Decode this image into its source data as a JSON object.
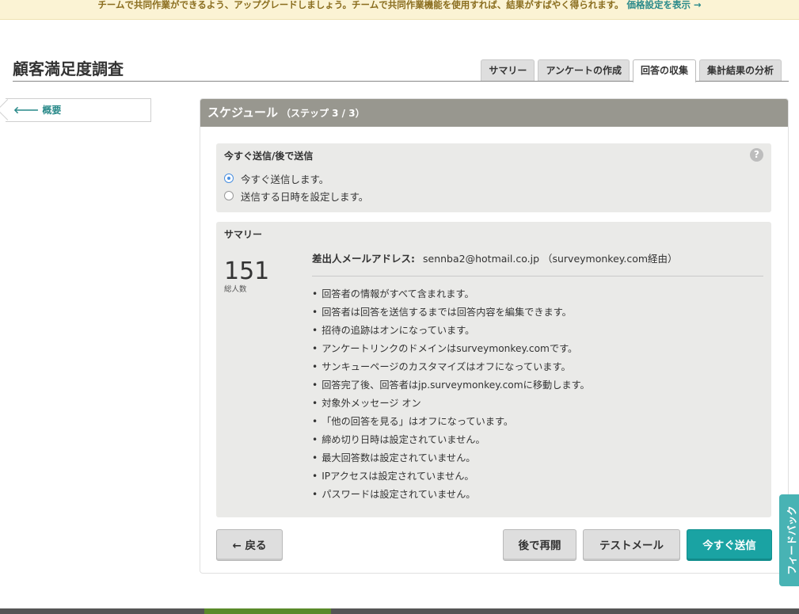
{
  "banner": {
    "text": "チームで共同作業ができるよう、アップグレードしましょう。チームで共同作業機能を使用すれば、結果がすばやく得られます。",
    "link": "価格設定を表示 →"
  },
  "page_title": "顧客満足度調査",
  "tabs": [
    "サマリー",
    "アンケートの作成",
    "回答の収集",
    "集計結果の分析"
  ],
  "active_tab": "回答の収集",
  "back_link": "🡐 概要",
  "panel": {
    "title": "スケジュール",
    "step": "（ステップ 3 / 3）"
  },
  "send_options": {
    "label": "今すぐ送信/後で送信",
    "help": "?",
    "options": [
      {
        "label": "今すぐ送信します。",
        "selected": true
      },
      {
        "label": "送信する日時を設定します。",
        "selected": false
      }
    ]
  },
  "summary": {
    "label": "サマリー",
    "count": "151",
    "count_label": "総人数",
    "sender_label": "差出人メールアドレス:",
    "sender_value": "sennba2@hotmail.co.jp （surveymonkey.com経由）",
    "bullets": [
      "回答者の情報がすべて含まれます。",
      "回答者は回答を送信するまでは回答内容を編集できます。",
      "招待の追跡はオンになっています。",
      "アンケートリンクのドメインはsurveymonkey.comです。",
      "サンキューページのカスタマイズはオフになっています。",
      "回答完了後、回答者はjp.surveymonkey.comに移動します。",
      "対象外メッセージ オン",
      "「他の回答を見る」はオフになっています。",
      "締め切り日時は設定されていません。",
      "最大回答数は設定されていません。",
      "IPアクセスは設定されていません。",
      "パスワードは設定されていません。"
    ]
  },
  "buttons": {
    "back": "← 戻る",
    "resume_later": "後で再開",
    "test_mail": "テストメール",
    "send_now": "今すぐ送信"
  },
  "feedback": "フィードバック",
  "colors": {
    "accent": "#1aa3a3",
    "header": "#98978f",
    "banner_bg": "#fbf3d4",
    "radio_selected": "#4a8fe0"
  }
}
